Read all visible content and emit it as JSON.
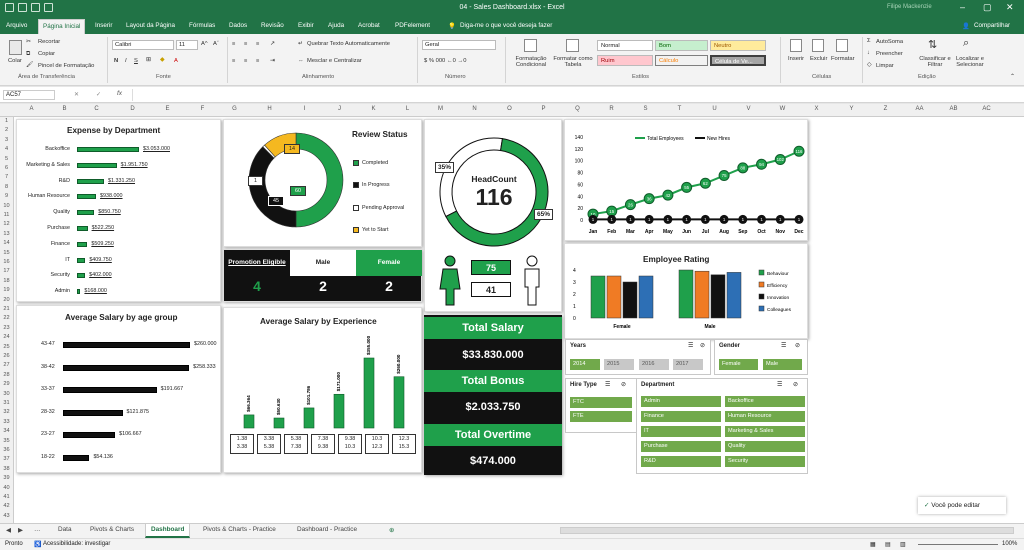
{
  "app": {
    "title": "04 - Sales Dashboard.xlsx  -  Excel",
    "user": "Filipe Mackenzie",
    "share": "Compartilhar"
  },
  "menu": {
    "tabs": [
      "Arquivo",
      "Página Inicial",
      "Inserir",
      "Layout da Página",
      "Fórmulas",
      "Dados",
      "Revisão",
      "Exibir",
      "Ajuda",
      "Acrobat",
      "PDFelement"
    ],
    "tell": "Diga-me o que você deseja fazer"
  },
  "ribbon": {
    "paste": "Colar",
    "cut": "Recortar",
    "copy": "Copiar",
    "painter": "Pincel de Formatação",
    "font_name": "Calibri",
    "font_size": "11",
    "wrap": "Quebrar Texto Automaticamente",
    "merge": "Mesclar e Centralizar",
    "number_format": "Geral",
    "cond_format": "Formatação Condicional",
    "format_table": "Formatar como Tabela",
    "styles": {
      "normal": "Normal",
      "bom": "Bom",
      "neutro": "Neutro",
      "ruim": "Ruim",
      "calculo": "Cálculo",
      "celula": "Célula de Ve..."
    },
    "insert": "Inserir",
    "delete": "Excluir",
    "format": "Formatar",
    "autosum": "AutoSoma",
    "fill": "Preencher",
    "clear": "Limpar",
    "sort": "Classificar e Filtrar",
    "find": "Localizar e Selecionar",
    "groups": [
      "Área de Transferência",
      "Fonte",
      "Alinhamento",
      "Número",
      "Estilos",
      "Células",
      "Edição"
    ]
  },
  "formula_bar": {
    "name_box": "AC57",
    "fx": "fx",
    "value": ""
  },
  "columns": [
    "A",
    "B",
    "C",
    "D",
    "E",
    "F",
    "G",
    "H",
    "I",
    "J",
    "K",
    "L",
    "M",
    "N",
    "O",
    "P",
    "Q",
    "R",
    "S",
    "T",
    "U",
    "V",
    "W",
    "X",
    "Y",
    "Z",
    "AA",
    "AB",
    "AC"
  ],
  "rows": [
    "1",
    "2",
    "3",
    "4",
    "5",
    "6",
    "7",
    "8",
    "9",
    "10",
    "11",
    "12",
    "13",
    "14",
    "15",
    "16",
    "17",
    "18",
    "19",
    "20",
    "21",
    "22",
    "23",
    "24",
    "25",
    "26",
    "27",
    "28",
    "29",
    "30",
    "31",
    "32",
    "33",
    "34",
    "35",
    "36",
    "37",
    "38",
    "39",
    "40",
    "41",
    "42",
    "43"
  ],
  "expense": {
    "title": "Expense by Department",
    "items": [
      {
        "dept": "Backoffice",
        "label": "$3.053.000",
        "value": 3053000
      },
      {
        "dept": "Marketing & Sales",
        "label": "$1.951.750",
        "value": 1951750
      },
      {
        "dept": "R&D",
        "label": "$1.331.250",
        "value": 1331250
      },
      {
        "dept": "Human Resource",
        "label": "$938.000",
        "value": 938000
      },
      {
        "dept": "Quality",
        "label": "$850.750",
        "value": 850750
      },
      {
        "dept": "Purchase",
        "label": "$522.250",
        "value": 522250
      },
      {
        "dept": "Finance",
        "label": "$509.250",
        "value": 509250
      },
      {
        "dept": "IT",
        "label": "$409.750",
        "value": 409750
      },
      {
        "dept": "Security",
        "label": "$402.000",
        "value": 402000
      },
      {
        "dept": "Admin",
        "label": "$168.000",
        "value": 168000
      }
    ]
  },
  "review": {
    "title": "Review Status",
    "legend": [
      "Completed",
      "In Progress",
      "Pending Approval",
      "Yet to Start"
    ],
    "values": {
      "completed": "60",
      "in_progress": "45",
      "pending": "1",
      "yet": "14"
    },
    "colors": [
      "#1fa04b",
      "#111111",
      "#ffffff",
      "#f5b820"
    ]
  },
  "promotion": {
    "header": "Promotion Eligible",
    "male": "Male",
    "female": "Female",
    "total": "4",
    "male_count": "2",
    "female_count": "2"
  },
  "headcount": {
    "title": "HeadCount",
    "value": "116",
    "pct_female": "35%",
    "pct_male": "65%",
    "female": "75",
    "male": "41"
  },
  "employees_chart": {
    "legend": [
      "Total Employees",
      "New Hires"
    ],
    "yticks": [
      "0",
      "20",
      "40",
      "60",
      "80",
      "100",
      "120",
      "140"
    ],
    "months": [
      "Jan",
      "Feb",
      "Mar",
      "Apr",
      "May",
      "Jun",
      "Jul",
      "Aug",
      "Sep",
      "Oct",
      "Nov",
      "Dec"
    ],
    "total": [
      10,
      15,
      26,
      36,
      42,
      55,
      62,
      75,
      88,
      94,
      102,
      116
    ],
    "hires": [
      "1",
      "1",
      "1",
      "1",
      "1",
      "1",
      "1",
      "1",
      "1",
      "1",
      "1",
      "1"
    ],
    "total_labels": [
      "10",
      "15",
      "26",
      "36",
      "42",
      "55",
      "62",
      "75",
      "88",
      "94",
      "102",
      "116"
    ],
    "hires_labels": [
      "1",
      "1",
      "1",
      "1",
      "1",
      "1",
      "1",
      "1",
      "1",
      "1",
      "1",
      "1"
    ]
  },
  "rating": {
    "title": "Employee Rating",
    "legend": [
      "Behaviour",
      "Efficiency",
      "Innovation",
      "Colleagues"
    ],
    "colors": [
      "#1fa04b",
      "#f07b24",
      "#111111",
      "#2d6fb5"
    ],
    "groups": [
      "Female",
      "Male"
    ],
    "female": [
      3.5,
      3.5,
      3.0,
      3.5
    ],
    "male": [
      4.0,
      3.9,
      3.6,
      3.8
    ],
    "yticks": [
      "0",
      "1",
      "2",
      "3",
      "4"
    ]
  },
  "salary_kpi": {
    "total_salary_label": "Total Salary",
    "total_salary": "$33.830.000",
    "total_bonus_label": "Total Bonus",
    "total_bonus": "$2.033.750",
    "total_overtime_label": "Total Overtime",
    "total_overtime": "$474.000"
  },
  "age_salary": {
    "title": "Average Salary by age group",
    "items": [
      {
        "age": "43-47",
        "label": "$260.000",
        "value": 260000
      },
      {
        "age": "38-42",
        "label": "$258.333",
        "value": 258333
      },
      {
        "age": "33-37",
        "label": "$191.667",
        "value": 191667
      },
      {
        "age": "28-32",
        "label": "$121.875",
        "value": 121875
      },
      {
        "age": "23-27",
        "label": "$106.667",
        "value": 106667
      },
      {
        "age": "18-22",
        "label": "$54.136",
        "value": 54136
      }
    ]
  },
  "experience": {
    "title": "Average Salary by Experience",
    "labels": [
      "$66.364",
      "$50.630",
      "$101.786",
      "$171.000",
      "$355.000",
      "$260.000"
    ],
    "values": [
      66364,
      50630,
      101786,
      171000,
      355000,
      260000
    ],
    "ranges": [
      [
        "1.38",
        "3.38"
      ],
      [
        "3.38",
        "5.38"
      ],
      [
        "5.38",
        "7.38"
      ],
      [
        "7.38",
        "9.38"
      ],
      [
        "9.38",
        "10.3"
      ],
      [
        "10.3",
        "12.3"
      ],
      [
        "12.3",
        "15.3"
      ]
    ]
  },
  "slicers": {
    "years": {
      "title": "Years",
      "items": [
        "2014",
        "2015",
        "2016",
        "2017"
      ]
    },
    "gender": {
      "title": "Gender",
      "items": [
        "Female",
        "Male"
      ]
    },
    "hire": {
      "title": "Hire Type",
      "items": [
        "FTC",
        "FTE"
      ]
    },
    "dept": {
      "title": "Department",
      "items": [
        "Admin",
        "Backoffice",
        "Finance",
        "Human Resource",
        "IT",
        "Marketing & Sales",
        "Purchase",
        "Quality",
        "R&D",
        "Security"
      ]
    }
  },
  "sheets": {
    "tabs": [
      "Data",
      "Pivots & Charts",
      "Dashboard",
      "Pivots & Charts - Practice",
      "Dashboard - Practice"
    ],
    "active": "Dashboard"
  },
  "status": {
    "ready": "Pronto",
    "accessibility": "Acessibilidade: investigar",
    "edit_notice": "Você pode editar",
    "zoom": "100%"
  }
}
